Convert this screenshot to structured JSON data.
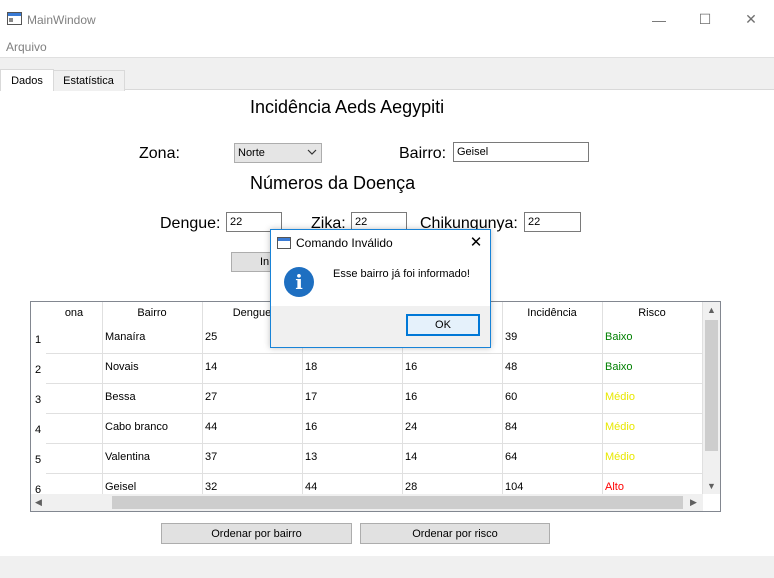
{
  "window": {
    "title": "MainWindow",
    "minimize": "—",
    "maximize": "☐",
    "close": "✕"
  },
  "menu": {
    "file": "Arquivo"
  },
  "tabs": [
    {
      "label": "Dados"
    },
    {
      "label": "Estatística"
    }
  ],
  "form": {
    "title": "Incidência Aeds Aegypiti",
    "zona_label": "Zona:",
    "zona_value": "Norte",
    "bairro_label": "Bairro:",
    "bairro_value": "Geisel",
    "subtitle": "Números da Doença",
    "dengue_label": "Dengue:",
    "dengue_value": "22",
    "zika_label": "Zika:",
    "zika_value": "22",
    "chik_label": "Chikungunya:",
    "chik_value": "22",
    "insert_button_partial": "In"
  },
  "table": {
    "headers": [
      "ona",
      "Bairro",
      "Dengue",
      "",
      "",
      "Incidência",
      "Risco"
    ],
    "rows": [
      {
        "num": "1",
        "zona": "",
        "bairro": "Manaíra",
        "dengue": "25",
        "zika": "",
        "chik": "",
        "incidencia": "39",
        "risco": "Baixo"
      },
      {
        "num": "2",
        "zona": "",
        "bairro": "Novais",
        "dengue": "14",
        "zika": "18",
        "chik": "16",
        "incidencia": "48",
        "risco": "Baixo"
      },
      {
        "num": "3",
        "zona": "",
        "bairro": "Bessa",
        "dengue": "27",
        "zika": "17",
        "chik": "16",
        "incidencia": "60",
        "risco": "Médio"
      },
      {
        "num": "4",
        "zona": "",
        "bairro": "Cabo branco",
        "dengue": "44",
        "zika": "16",
        "chik": "24",
        "incidencia": "84",
        "risco": "Médio"
      },
      {
        "num": "5",
        "zona": "",
        "bairro": "Valentina",
        "dengue": "37",
        "zika": "13",
        "chik": "14",
        "incidencia": "64",
        "risco": "Médio"
      },
      {
        "num": "6",
        "zona": "",
        "bairro": "Geisel",
        "dengue": "32",
        "zika": "44",
        "chik": "28",
        "incidencia": "104",
        "risco": "Alto"
      }
    ],
    "risk_colors": {
      "Baixo": "#008000",
      "Médio": "#e8e800",
      "Alto": "#ff0000"
    }
  },
  "buttons": {
    "sort_bairro": "Ordenar por bairro",
    "sort_risco": "Ordenar por risco"
  },
  "dialog": {
    "title": "Comando Inválido",
    "message": "Esse bairro já foi informado!",
    "ok": "OK",
    "close": "✕",
    "info_glyph": "i"
  },
  "scroll_arrows": {
    "up": "▲",
    "down": "▼",
    "left": "◀",
    "right": "▶"
  }
}
